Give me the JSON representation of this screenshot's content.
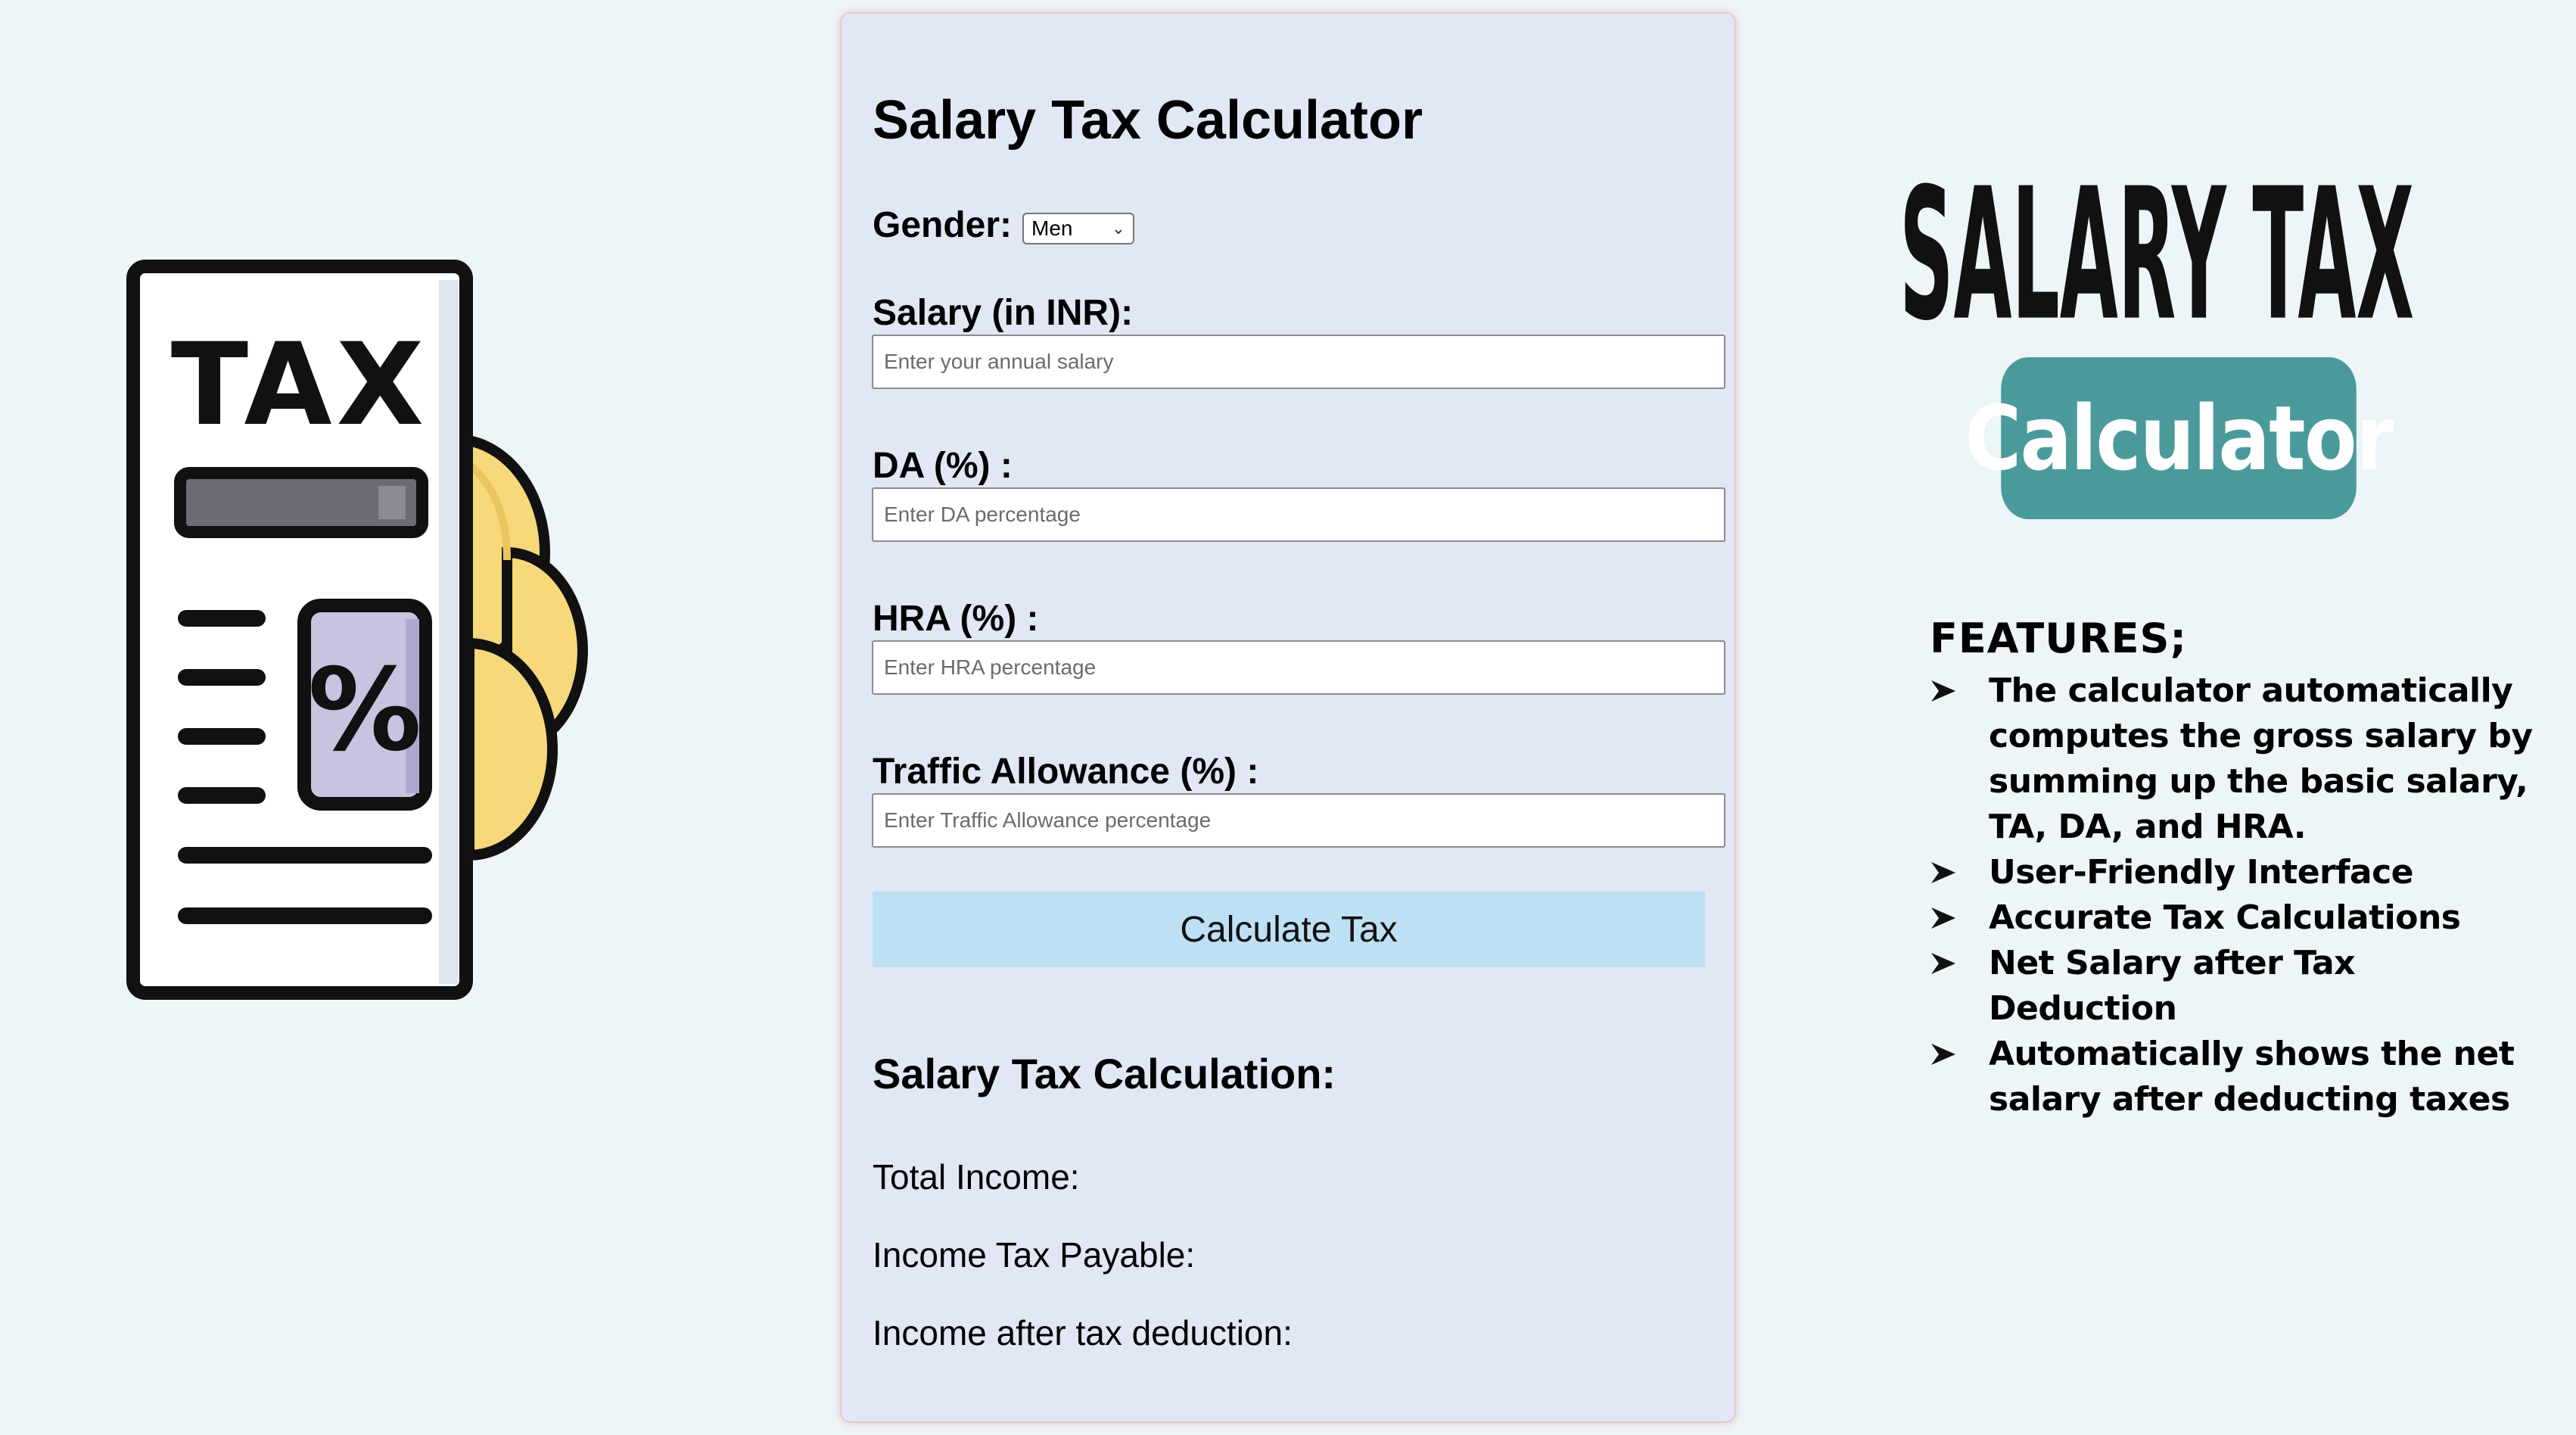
{
  "form": {
    "title": "Salary Tax Calculator",
    "gender_label": "Gender:",
    "gender_value": "Men",
    "salary_label": "Salary (in INR):",
    "salary_placeholder": "Enter your annual salary",
    "da_label": "DA (%) :",
    "da_placeholder": "Enter DA percentage",
    "hra_label": "HRA (%) :",
    "hra_placeholder": "Enter HRA percentage",
    "ta_label": "Traffic Allowance (%) :",
    "ta_placeholder": "Enter Traffic Allowance percentage",
    "button_label": "Calculate Tax"
  },
  "results": {
    "title": "Salary Tax Calculation:",
    "total_income": "Total Income:",
    "tax_payable": "Income Tax Payable:",
    "net_income": "Income after tax deduction:"
  },
  "illustration": {
    "text": "TAX",
    "percent_icon": "%"
  },
  "branding": {
    "title": "SALARY TAX",
    "badge": "Calculator",
    "badge_color": "#4a9a9c"
  },
  "features": {
    "title": "FEATURES;",
    "items": [
      "The calculator automatically computes the gross salary by summing up the basic salary, TA, DA, and HRA.",
      "User-Friendly Interface",
      "Accurate Tax Calculations",
      "Net Salary after Tax Deduction",
      "Automatically shows the net salary after deducting taxes"
    ]
  },
  "colors": {
    "page_bg": "#eef5f9",
    "card_bg": "#e1e7f4",
    "button_bg": "#bde0f5",
    "coin": "#f7d87a"
  }
}
